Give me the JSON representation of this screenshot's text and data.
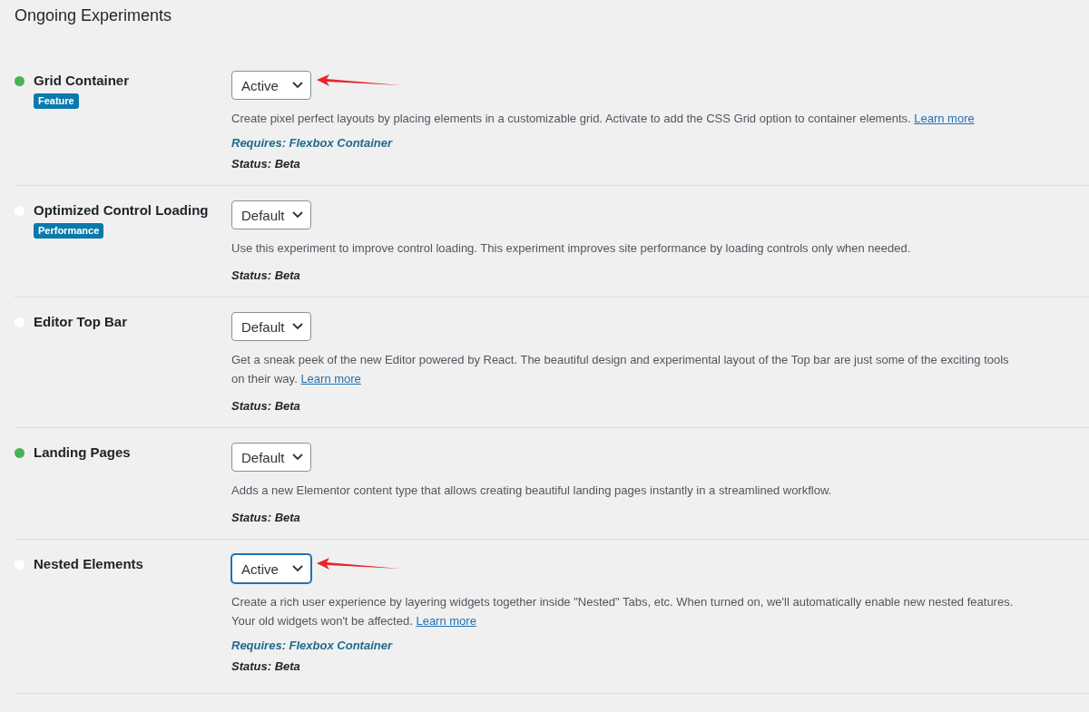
{
  "heading": "Ongoing Experiments",
  "experiments": [
    {
      "name": "Grid Container",
      "on": true,
      "tag": "Feature",
      "value": "Active",
      "focused": false,
      "arrow": true,
      "description": "Create pixel perfect layouts by placing elements in a customizable grid. Activate to add the CSS Grid option to container elements.",
      "link": "Learn more",
      "requires": "Requires: Flexbox Container",
      "status": "Status: Beta"
    },
    {
      "name": "Optimized Control Loading",
      "on": false,
      "tag": "Performance",
      "value": "Default",
      "focused": false,
      "arrow": false,
      "description": "Use this experiment to improve control loading. This experiment improves site performance by loading controls only when needed.",
      "status": "Status: Beta"
    },
    {
      "name": "Editor Top Bar",
      "on": false,
      "value": "Default",
      "focused": false,
      "arrow": false,
      "description": "Get a sneak peek of the new Editor powered by React. The beautiful design and experimental layout of the Top bar are just some of the exciting tools on their way.",
      "link": "Learn more",
      "status": "Status: Beta"
    },
    {
      "name": "Landing Pages",
      "on": true,
      "value": "Default",
      "focused": false,
      "arrow": false,
      "description": "Adds a new Elementor content type that allows creating beautiful landing pages instantly in a streamlined workflow.",
      "status": "Status: Beta"
    },
    {
      "name": "Nested Elements",
      "on": false,
      "value": "Active",
      "focused": true,
      "arrow": true,
      "description": "Create a rich user experience by layering widgets together inside \"Nested\" Tabs, etc. When turned on, we'll automatically enable new nested features. Your old widgets won't be affected.",
      "link": "Learn more",
      "requires": "Requires: Flexbox Container",
      "status": "Status: Beta"
    }
  ]
}
